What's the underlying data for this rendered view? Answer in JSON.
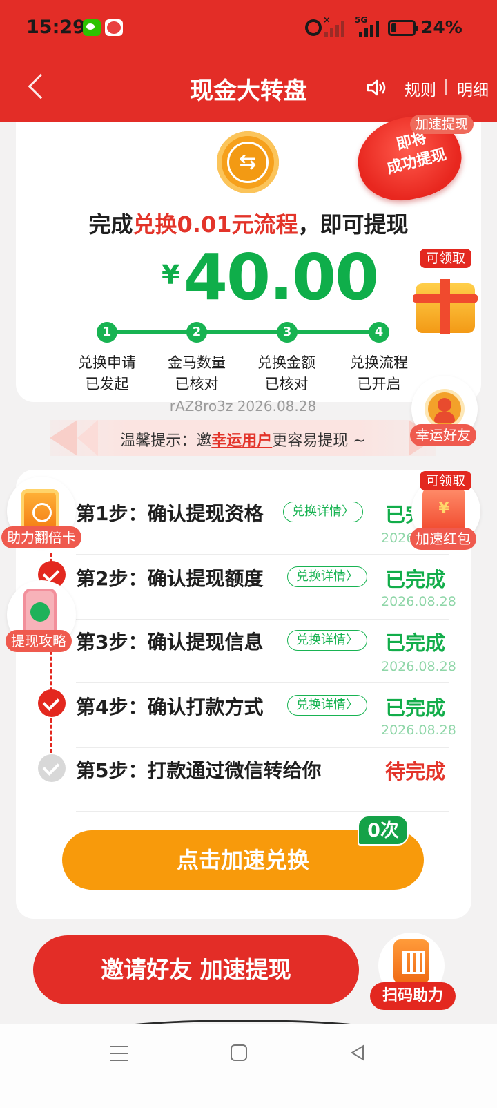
{
  "status_bar": {
    "time": "15:29",
    "signal_5g": "5G",
    "battery_level": 0.24,
    "battery": "24%",
    "icons": [
      "wechat-icon",
      "app-icon",
      "alarm-icon",
      "signal-icon",
      "battery-icon"
    ]
  },
  "header": {
    "title": "现金大转盘",
    "rules": "规则",
    "detail": "明细"
  },
  "hero": {
    "headline_prefix": "完成",
    "headline_highlight": "兑换0.01元流程",
    "headline_suffix": "，即可提现",
    "currency": "¥",
    "amount": "40.00",
    "steps": [
      {
        "num": "1",
        "line1": "兑换申请",
        "line2": "已发起"
      },
      {
        "num": "2",
        "line1": "金马数量",
        "line2": "已核对"
      },
      {
        "num": "3",
        "line1": "兑换金额",
        "line2": "已核对"
      },
      {
        "num": "4",
        "line1": "兑换流程",
        "line2": "已开启"
      }
    ],
    "seal_text_1": "即将",
    "seal_text_2": "成功提现",
    "speed_tag": "加速提现"
  },
  "serial": "rAZ8ro3z 2026.08.28",
  "tip": {
    "prefix": "温馨提示：邀",
    "highlight": "幸运用户",
    "suffix": "更容易提现 ~"
  },
  "floaters": {
    "claim_1": "可领取",
    "lucky_friend": "幸运好友",
    "claim_2": "可领取",
    "speed_redpack": "加速红包",
    "boost_card": "助力翻倍卡",
    "strategy": "提现攻略",
    "scan_help": "扫码助力"
  },
  "steps": [
    {
      "title": "第1步：确认提现资格",
      "detail": "兑换详情",
      "status": "已完成",
      "date": "2026.08.28"
    },
    {
      "title": "第2步：确认提现额度",
      "detail": "兑换详情",
      "status": "已完成",
      "date": "2026.08.28"
    },
    {
      "title": "第3步：确认提现信息",
      "detail": "兑换详情",
      "status": "已完成",
      "date": "2026.08.28"
    },
    {
      "title": "第4步：确认打款方式",
      "detail": "兑换详情",
      "status": "已完成",
      "date": "2026.08.28"
    },
    {
      "title": "第5步：打款通过微信转给你",
      "status": "待完成"
    }
  ],
  "cta": {
    "label": "点击加速兑换",
    "times": "0次"
  },
  "invite": {
    "label": "邀请好友 加速提现"
  },
  "colors": {
    "brand_red": "#e32d27",
    "success_green": "#12ad4a",
    "cta_orange": "#f89a0b"
  }
}
